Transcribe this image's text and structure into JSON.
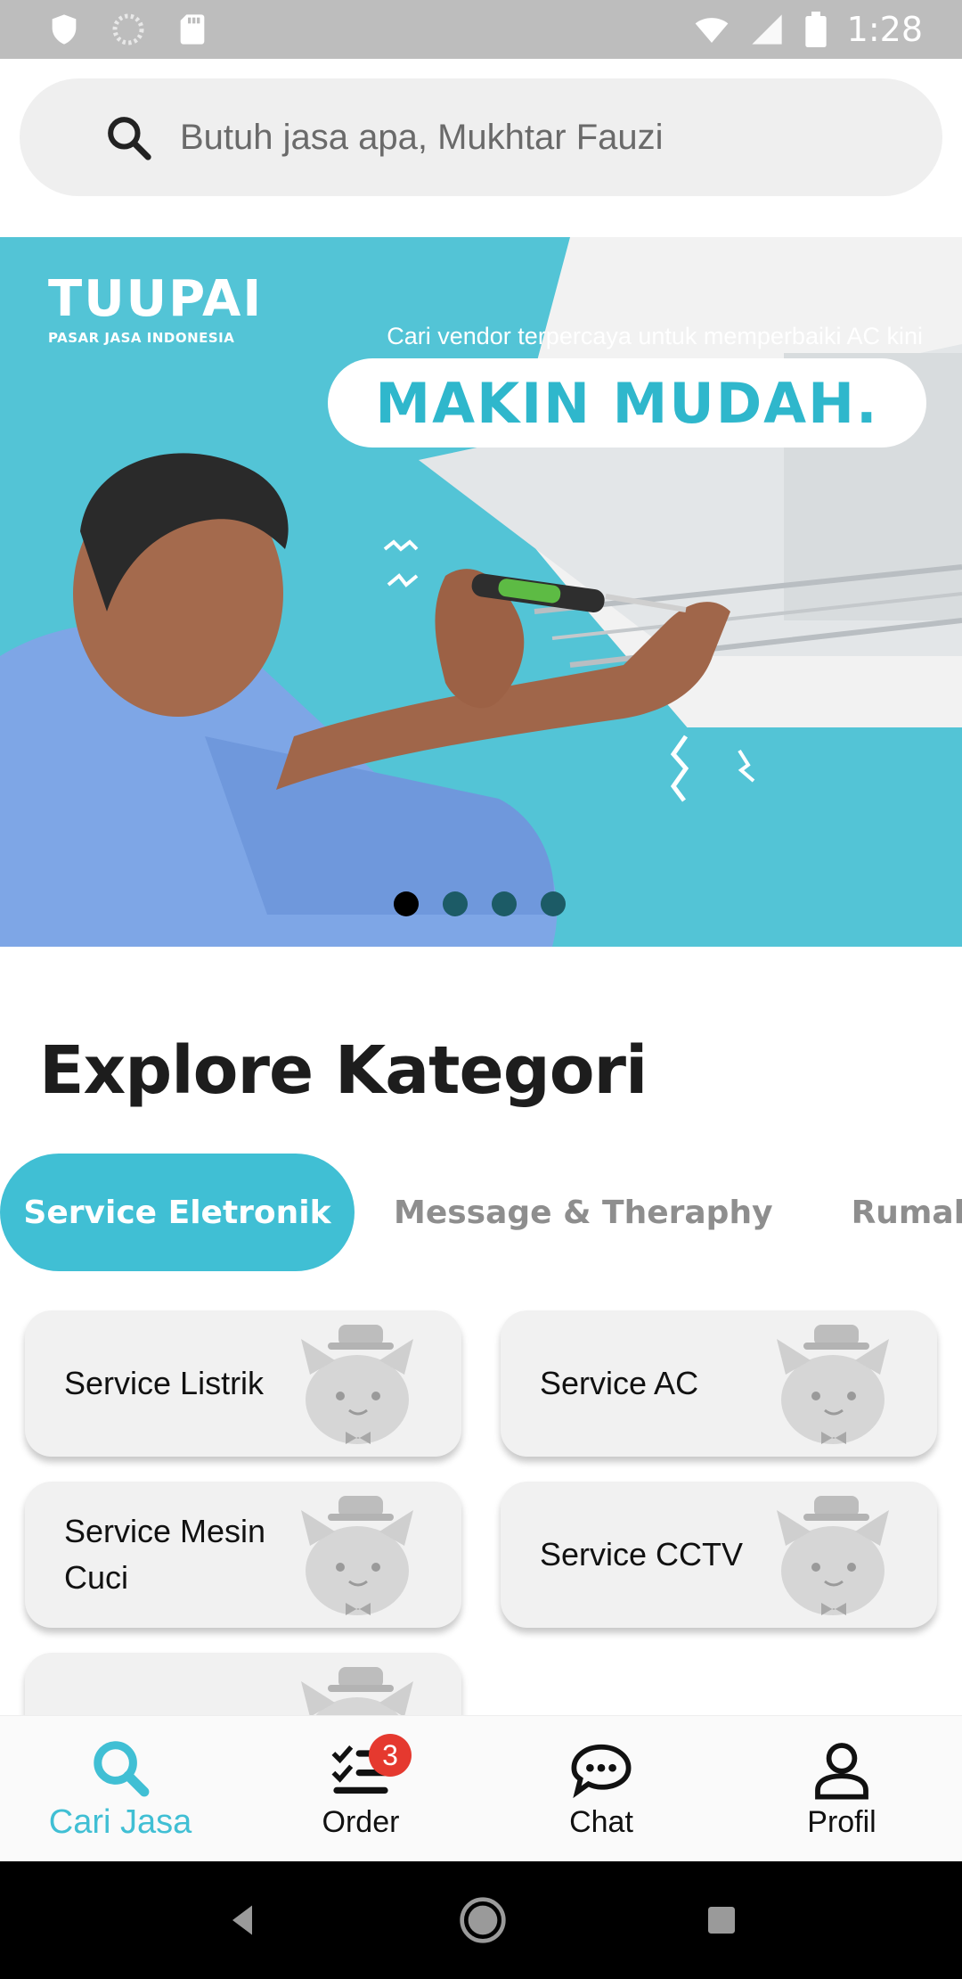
{
  "status_bar": {
    "time": "1:28",
    "icons": [
      "shield-icon",
      "circle-icon",
      "sd-card-icon",
      "wifi-icon",
      "signal-icon",
      "battery-icon"
    ]
  },
  "search": {
    "placeholder": "Butuh jasa apa, Mukhtar Fauzi"
  },
  "banner": {
    "brand_name": "TUUPAI",
    "brand_tagline": "PASAR JASA INDONESIA",
    "subtitle": "Cari vendor terpercaya untuk memperbaiki AC kini",
    "headline": "MAKIN MUDAH.",
    "slides_total": 4,
    "active_slide": 1
  },
  "section": {
    "title": "Explore Kategori"
  },
  "tabs": [
    {
      "label": "Service Eletronik",
      "active": true
    },
    {
      "label": "Message & Theraphy",
      "active": false
    },
    {
      "label": "Rumah T",
      "active": false
    }
  ],
  "categories": [
    {
      "label": "Service Listrik"
    },
    {
      "label": "Service AC"
    },
    {
      "label": "Service Mesin Cuci"
    },
    {
      "label": "Service CCTV"
    },
    {
      "label": ""
    }
  ],
  "bottom_nav": {
    "items": [
      {
        "label": "Cari Jasa",
        "icon": "search-icon",
        "active": true
      },
      {
        "label": "Order",
        "icon": "checklist-icon",
        "badge": "3"
      },
      {
        "label": "Chat",
        "icon": "chat-bubble-icon"
      },
      {
        "label": "Profil",
        "icon": "person-icon"
      }
    ]
  },
  "colors": {
    "accent": "#40bfd4",
    "banner_bg": "#53c4d6",
    "badge": "#e5392f"
  }
}
